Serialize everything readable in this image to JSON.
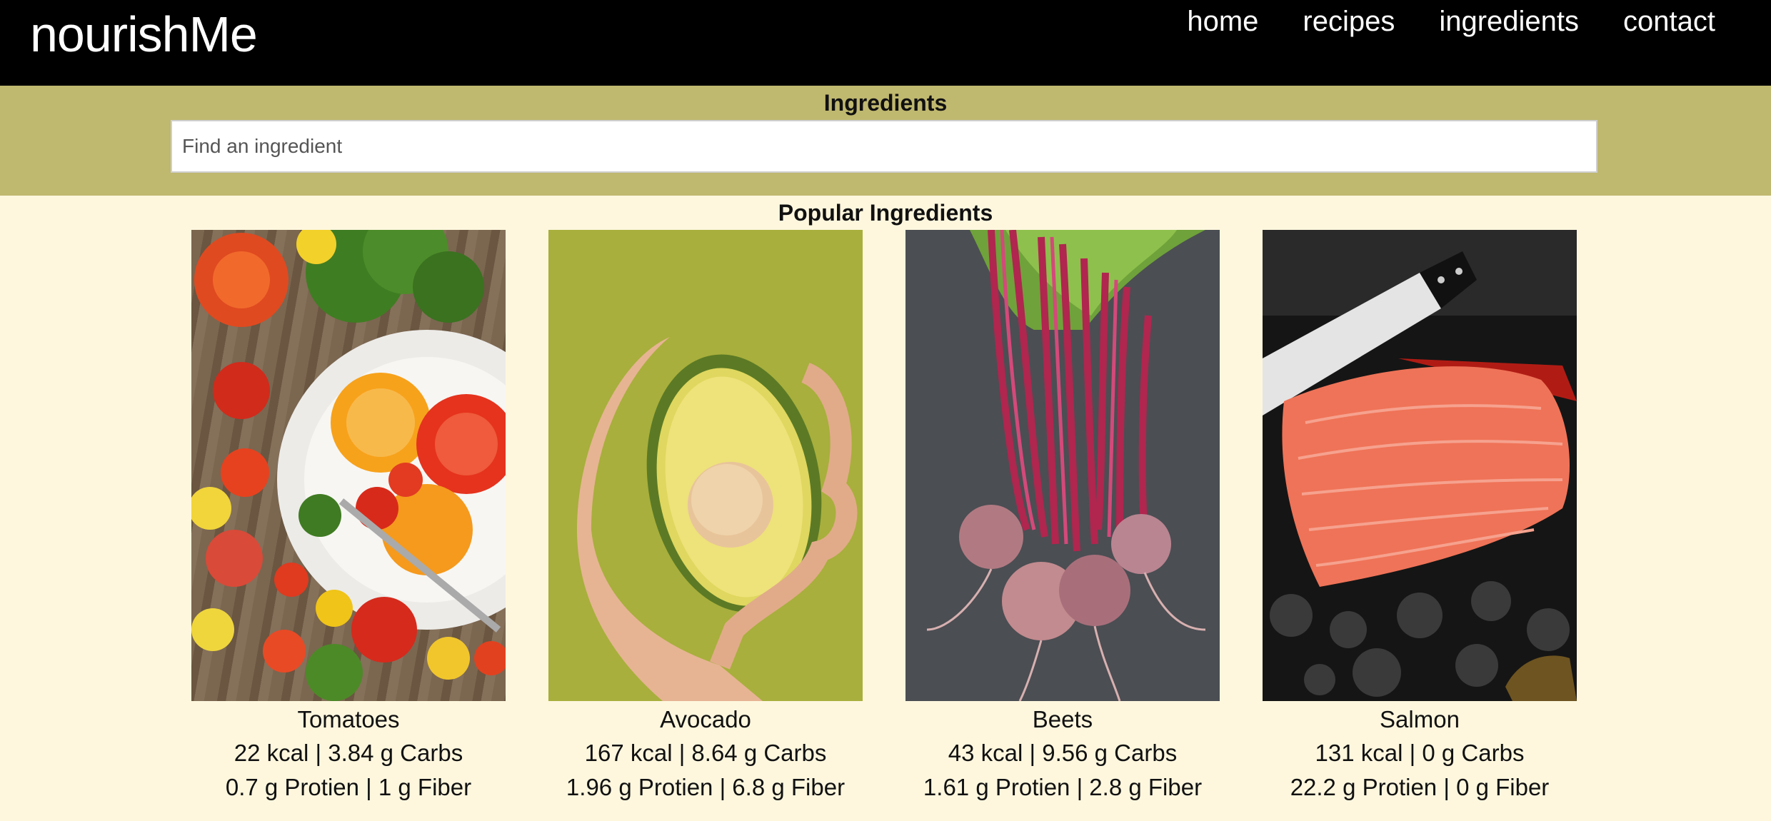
{
  "header": {
    "logo": "nourishMe",
    "nav": [
      "home",
      "recipes",
      "ingredients",
      "contact"
    ]
  },
  "search": {
    "title": "Ingredients",
    "placeholder": "Find an ingredient"
  },
  "popular": {
    "title": "Popular Ingredients",
    "items": [
      {
        "name": "Tomatoes",
        "line1": "22 kcal | 3.84 g Carbs",
        "line2": "0.7 g Protien | 1 g Fiber"
      },
      {
        "name": "Avocado",
        "line1": "167 kcal | 8.64 g Carbs",
        "line2": "1.96 g Protien | 6.8 g Fiber"
      },
      {
        "name": "Beets",
        "line1": "43 kcal | 9.56 g Carbs",
        "line2": "1.61 g Protien | 2.8 g Fiber"
      },
      {
        "name": "Salmon",
        "line1": "131 kcal | 0 g Carbs",
        "line2": "22.2 g Protien | 0 g Fiber"
      }
    ]
  },
  "colors": {
    "header_bg": "#000000",
    "search_band": "#bfb86f",
    "page_bg": "#fef7de"
  }
}
